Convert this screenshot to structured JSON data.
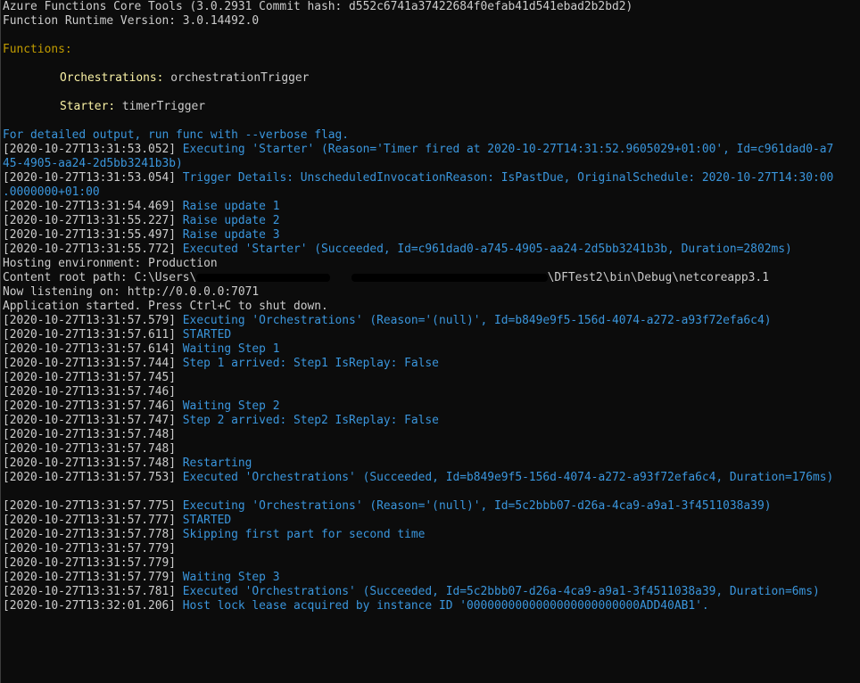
{
  "header": {
    "tools_line": "Azure Functions Core Tools (3.0.2931 Commit hash: d552c6741a37422684f0efab41d541ebad2b2bd2)",
    "runtime_line": "Function Runtime Version: 3.0.14492.0"
  },
  "functions": {
    "heading": "Functions:",
    "items": [
      {
        "name": "Orchestrations:",
        "trigger": "orchestrationTrigger"
      },
      {
        "name": "Starter:",
        "trigger": "timerTrigger"
      }
    ]
  },
  "verbose_hint": "For detailed output, run func with --verbose flag.",
  "log": [
    {
      "ts": "[2020-10-27T13:31:53.052]",
      "msg": "Executing 'Starter' (Reason='Timer fired at 2020-10-27T14:31:52.9605029+01:00', Id=c961dad0-a7"
    },
    {
      "ts": "",
      "msg": "45-4905-aa24-2d5bb3241b3b)"
    },
    {
      "ts": "[2020-10-27T13:31:53.054]",
      "msg": "Trigger Details: UnscheduledInvocationReason: IsPastDue, OriginalSchedule: 2020-10-27T14:30:00"
    },
    {
      "ts": "",
      "msg": ".0000000+01:00"
    },
    {
      "ts": "[2020-10-27T13:31:54.469]",
      "msg": "Raise update 1"
    },
    {
      "ts": "[2020-10-27T13:31:55.227]",
      "msg": "Raise update 2"
    },
    {
      "ts": "[2020-10-27T13:31:55.497]",
      "msg": "Raise update 3"
    },
    {
      "ts": "[2020-10-27T13:31:55.772]",
      "msg": "Executed 'Starter' (Succeeded, Id=c961dad0-a745-4905-aa24-2d5bb3241b3b, Duration=2802ms)"
    }
  ],
  "host": {
    "environment": "Hosting environment: Production",
    "content_root_prefix": "Content root path: C:\\Users\\",
    "content_root_suffix": "\\DFTest2\\bin\\Debug\\netcoreapp3.1",
    "listening": "Now listening on: http://0.0.0.0:7071",
    "started": "Application started. Press Ctrl+C to shut down."
  },
  "log2": [
    {
      "ts": "[2020-10-27T13:31:57.579]",
      "msg": "Executing 'Orchestrations' (Reason='(null)', Id=b849e9f5-156d-4074-a272-a93f72efa6c4)"
    },
    {
      "ts": "[2020-10-27T13:31:57.611]",
      "msg": "STARTED"
    },
    {
      "ts": "[2020-10-27T13:31:57.614]",
      "msg": "Waiting Step 1"
    },
    {
      "ts": "[2020-10-27T13:31:57.744]",
      "msg": "Step 1 arrived: Step1 IsReplay: False"
    },
    {
      "ts": "[2020-10-27T13:31:57.745]",
      "msg": ""
    },
    {
      "ts": "[2020-10-27T13:31:57.746]",
      "msg": ""
    },
    {
      "ts": "[2020-10-27T13:31:57.746]",
      "msg": "Waiting Step 2"
    },
    {
      "ts": "[2020-10-27T13:31:57.747]",
      "msg": "Step 2 arrived: Step2 IsReplay: False"
    },
    {
      "ts": "[2020-10-27T13:31:57.748]",
      "msg": ""
    },
    {
      "ts": "[2020-10-27T13:31:57.748]",
      "msg": ""
    },
    {
      "ts": "[2020-10-27T13:31:57.748]",
      "msg": "Restarting"
    },
    {
      "ts": "[2020-10-27T13:31:57.753]",
      "msg": "Executed 'Orchestrations' (Succeeded, Id=b849e9f5-156d-4074-a272-a93f72efa6c4, Duration=176ms)"
    }
  ],
  "log3": [
    {
      "ts": "[2020-10-27T13:31:57.775]",
      "msg": "Executing 'Orchestrations' (Reason='(null)', Id=5c2bbb07-d26a-4ca9-a9a1-3f4511038a39)"
    },
    {
      "ts": "[2020-10-27T13:31:57.777]",
      "msg": "STARTED"
    },
    {
      "ts": "[2020-10-27T13:31:57.778]",
      "msg": "Skipping first part for second time"
    },
    {
      "ts": "[2020-10-27T13:31:57.779]",
      "msg": ""
    },
    {
      "ts": "[2020-10-27T13:31:57.779]",
      "msg": ""
    },
    {
      "ts": "[2020-10-27T13:31:57.779]",
      "msg": "Waiting Step 3"
    },
    {
      "ts": "[2020-10-27T13:31:57.781]",
      "msg": "Executed 'Orchestrations' (Succeeded, Id=5c2bbb07-d26a-4ca9-a9a1-3f4511038a39, Duration=6ms)"
    },
    {
      "ts": "[2020-10-27T13:32:01.206]",
      "msg": "Host lock lease acquired by instance ID '0000000000000000000000000ADD40AB1'."
    }
  ],
  "colors": {
    "background": "#0c0c0c",
    "default_text": "#cccccc",
    "info_text": "#3a96dd",
    "heading_text": "#c19c00",
    "label_text": "#f9f1a5"
  }
}
